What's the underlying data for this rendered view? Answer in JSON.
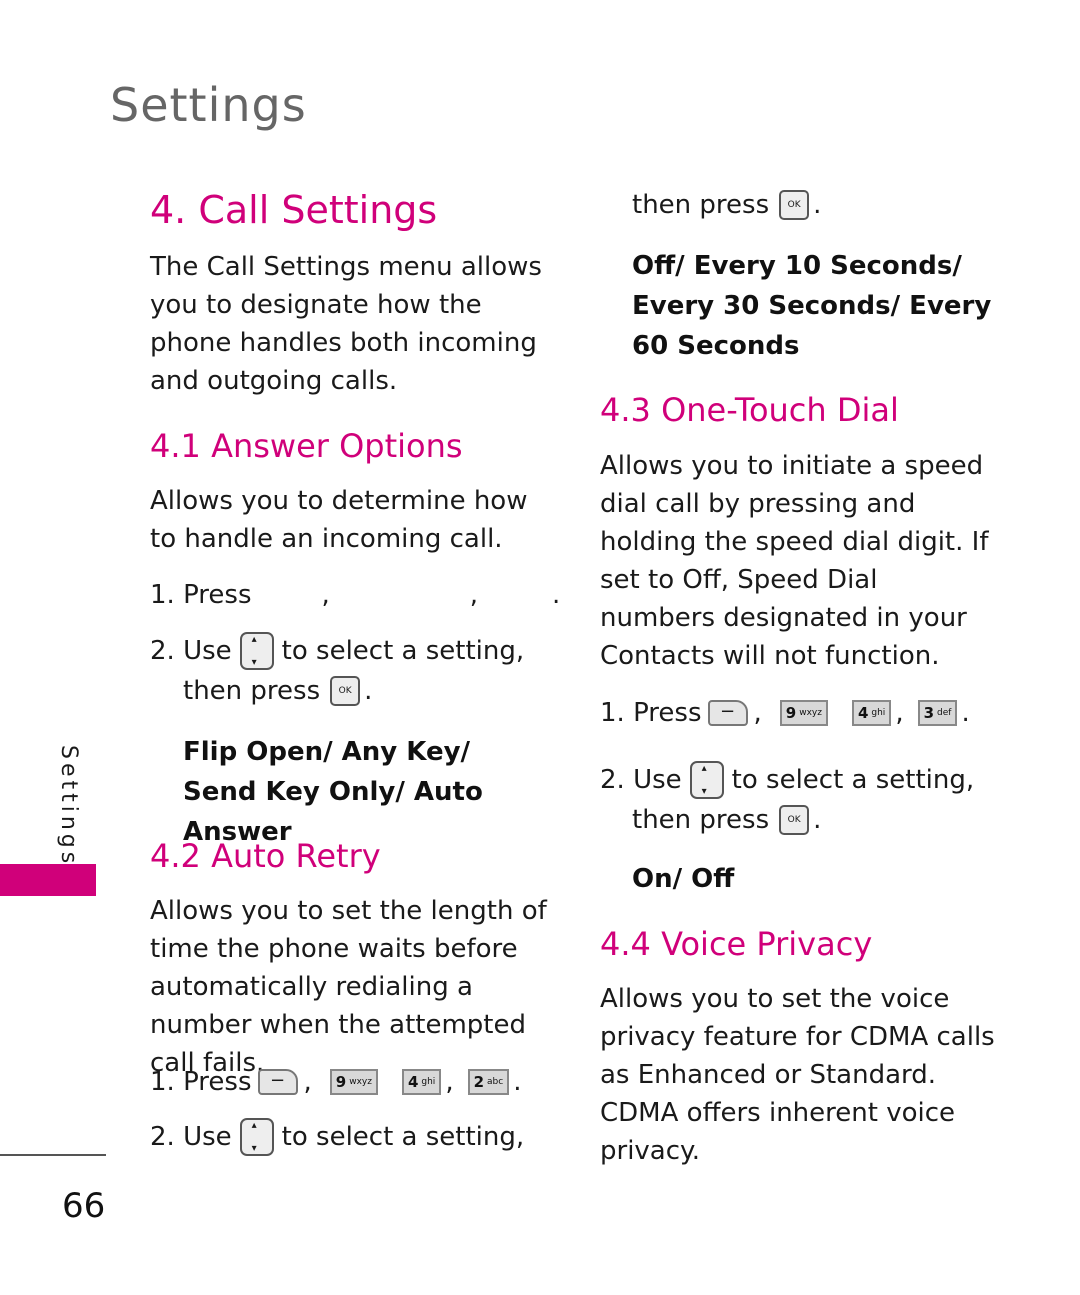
{
  "header": {
    "title": "Settings"
  },
  "side_tab": {
    "label": "Settings",
    "color": "#d0007a"
  },
  "page_number": "66",
  "accent_color": "#d0007a",
  "left": {
    "title": "4. Call Settings",
    "intro": "The Call Settings menu allows you to designate how the phone handles both incoming and outgoing calls.",
    "s41": {
      "heading": "4.1 Answer Options",
      "desc": "Allows you to determine how to handle an incoming call.",
      "step1": "1. Press",
      "step2a": "2. Use",
      "step2b": "to select a setting,",
      "step2c": "then press",
      "options": "Flip Open/ Any Key/ Send Key Only/ Auto Answer"
    },
    "s42": {
      "heading": "4.2 Auto Retry",
      "desc": "Allows you to set the length of time the phone waits before automatically redialing a number when the attempted call fails.",
      "step1": "1. Press",
      "keys": [
        "9",
        "wxyz",
        "4",
        "ghi",
        "2",
        "abc"
      ],
      "step2a": "2. Use",
      "step2b": "to select a setting,"
    }
  },
  "right": {
    "cont": "then press",
    "options42": "Off/ Every 10 Seconds/ Every 30 Seconds/ Every 60 Seconds",
    "s43": {
      "heading": "4.3 One-Touch Dial",
      "desc": "Allows you to initiate a speed dial call by pressing and holding the speed dial digit. If set to Off, Speed Dial numbers designated in your Contacts will not function.",
      "step1": "1. Press",
      "keys": [
        "9",
        "wxyz",
        "4",
        "ghi",
        "3",
        "def"
      ],
      "step2a": "2. Use",
      "step2b": "to select a setting,",
      "step2c": "then press",
      "options": "On/ Off"
    },
    "s44": {
      "heading": "4.4 Voice Privacy",
      "desc": "Allows you to set the voice privacy feature for CDMA calls as Enhanced or Standard. CDMA offers inherent voice privacy."
    }
  },
  "icons": {
    "ok": "OK",
    "soft": "−",
    "comma": ",",
    "period": "."
  }
}
